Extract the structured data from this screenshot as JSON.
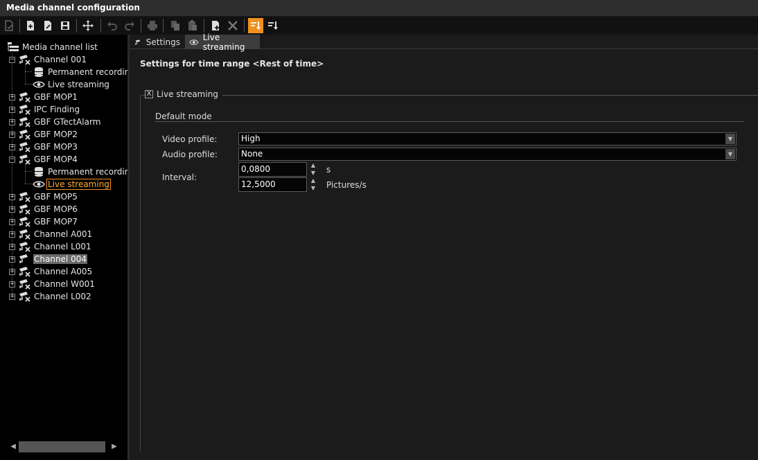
{
  "window": {
    "title": "Media channel configuration"
  },
  "toolbar": {
    "buttons": [
      {
        "icon": "commit-icon"
      },
      {
        "icon": "new-item-icon"
      },
      {
        "icon": "edit-item-icon"
      },
      {
        "icon": "save-icon"
      },
      {
        "icon": "move-icon"
      },
      {
        "icon": "undo-icon"
      },
      {
        "icon": "redo-icon"
      },
      {
        "icon": "print-icon"
      },
      {
        "icon": "copy-icon"
      },
      {
        "icon": "paste-icon"
      },
      {
        "icon": "add-icon"
      },
      {
        "icon": "delete-icon"
      },
      {
        "icon": "sort-active-icon"
      },
      {
        "icon": "sort-icon"
      }
    ]
  },
  "tree": {
    "root": "Media channel list",
    "channel_001": "Channel 001",
    "permanent_recording_1": "Permanent recordin",
    "live_streaming_1": "Live streaming",
    "gbf_mop1": "GBF MOP1",
    "ipc_finding": "IPC Finding",
    "gbf_gtectalarm": "GBF GTectAlarm",
    "gbf_mop2": "GBF MOP2",
    "gbf_mop3": "GBF MOP3",
    "gbf_mop4": "GBF MOP4",
    "permanent_recording_2": "Permanent recordin",
    "live_streaming_2": "Live streaming",
    "gbf_mop5": "GBF MOP5",
    "gbf_mop6": "GBF MOP6",
    "gbf_mop7": "GBF MOP7",
    "channel_a001": "Channel A001",
    "channel_l001": "Channel L001",
    "channel_004": "Channel 004",
    "channel_a005": "Channel A005",
    "channel_w001": "Channel W001",
    "channel_l002": "Channel L002"
  },
  "tabs": {
    "settings": "Settings",
    "live_streaming": "Live streaming"
  },
  "main": {
    "settings_title": "Settings for time range <Rest of time>",
    "live_streaming_checkbox": "Live streaming",
    "live_streaming_checked": "X",
    "default_mode": "Default mode",
    "video_profile_label": "Video profile:",
    "video_profile_value": "High",
    "audio_profile_label": "Audio profile:",
    "audio_profile_value": "None",
    "interval_label": "Interval:",
    "interval_seconds": "0,0800",
    "interval_seconds_unit": "s",
    "interval_fps": "12,5000",
    "interval_fps_unit": "Pictures/s"
  },
  "colors": {
    "accent": "#f0901e",
    "background": "#1b1b1b",
    "tree_background": "#000000"
  }
}
